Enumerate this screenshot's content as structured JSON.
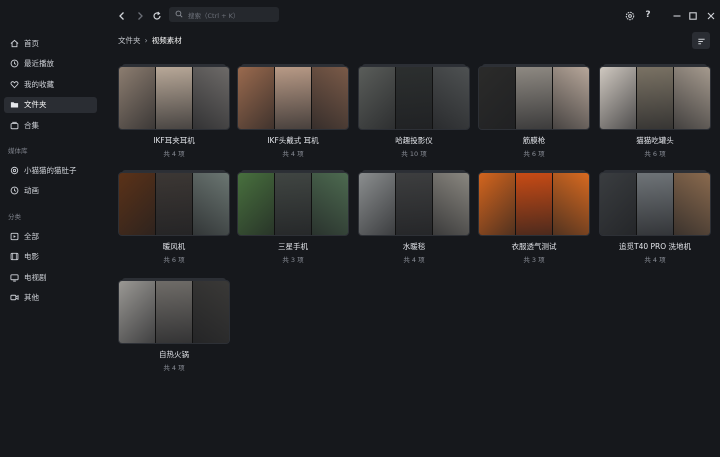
{
  "sidebar": {
    "nav": [
      {
        "label": "首页",
        "icon": "home-icon",
        "active": false
      },
      {
        "label": "最近播放",
        "icon": "clock-icon",
        "active": false
      },
      {
        "label": "我的收藏",
        "icon": "heart-icon",
        "active": false
      },
      {
        "label": "文件夹",
        "icon": "folder-icon",
        "active": true
      },
      {
        "label": "合集",
        "icon": "collection-icon",
        "active": false
      }
    ],
    "library_heading": "媒体库",
    "library": [
      {
        "label": "小猫猫的猫肚子",
        "icon": "settings-icon"
      },
      {
        "label": "动画",
        "icon": "clock-icon"
      }
    ],
    "category_heading": "分类",
    "categories": [
      {
        "label": "全部",
        "icon": "play-box-icon"
      },
      {
        "label": "电影",
        "icon": "film-icon"
      },
      {
        "label": "电视剧",
        "icon": "tv-icon"
      },
      {
        "label": "其他",
        "icon": "video-icon"
      }
    ]
  },
  "topbar": {
    "search_placeholder": "搜索（Ctrl + K）"
  },
  "breadcrumb": {
    "root": "文件夹",
    "current": "视频素材"
  },
  "folders": [
    {
      "title": "IKF耳夹耳机",
      "count": "共 4 项",
      "colors": [
        "#8c7d70",
        "#b8a898",
        "#6d6a68"
      ]
    },
    {
      "title": "IKF头戴式 耳机",
      "count": "共 4 项",
      "colors": [
        "#9a6a4e",
        "#b89a86",
        "#7a5a48"
      ]
    },
    {
      "title": "哈趣投影仪",
      "count": "共 10 项",
      "colors": [
        "#5a5d5a",
        "#2c2f2f",
        "#4e5152"
      ]
    },
    {
      "title": "筋膜枪",
      "count": "共 6 项",
      "colors": [
        "#2b2b2a",
        "#8e8982",
        "#b7a79a"
      ]
    },
    {
      "title": "猫猫吃罐头",
      "count": "共 6 项",
      "colors": [
        "#cfc8c0",
        "#7a7264",
        "#a59a8e"
      ]
    },
    {
      "title": "暖风机",
      "count": "共 6 项",
      "colors": [
        "#5b3218",
        "#3c3734",
        "#6b7672"
      ]
    },
    {
      "title": "三星手机",
      "count": "共 3 项",
      "colors": [
        "#48703e",
        "#404542",
        "#4d6a50"
      ]
    },
    {
      "title": "水暖毯",
      "count": "共 4 项",
      "colors": [
        "#8b8e8f",
        "#3d3e3f",
        "#8a8780"
      ]
    },
    {
      "title": "衣服透气测试",
      "count": "共 3 项",
      "colors": [
        "#d4651e",
        "#c84b15",
        "#d86a20"
      ]
    },
    {
      "title": "追觅T40 PRO 洗地机",
      "count": "共 4 项",
      "colors": [
        "#3a3d40",
        "#6f7478",
        "#8a6a4e"
      ]
    },
    {
      "title": "自热火锅",
      "count": "共 4 项",
      "colors": [
        "#9a9894",
        "#6f6c68",
        "#3a3937"
      ]
    }
  ]
}
